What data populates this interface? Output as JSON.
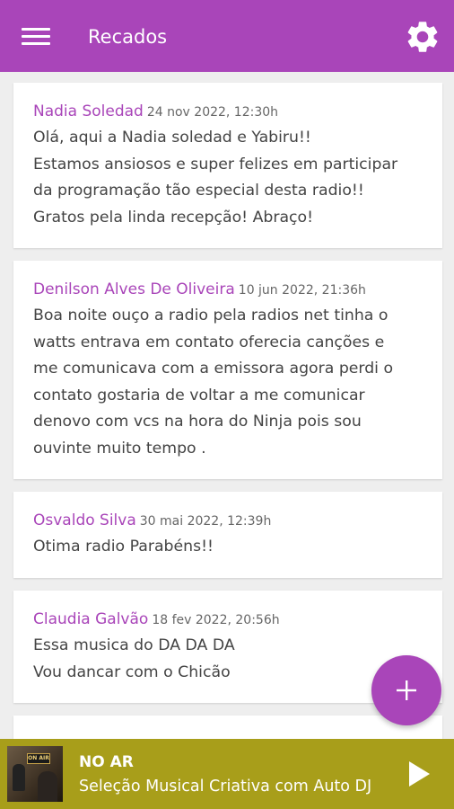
{
  "header": {
    "title": "Recados",
    "menu_icon": "hamburger-menu-icon",
    "settings_icon": "gear-icon",
    "background_color": "#a945b9"
  },
  "messages": [
    {
      "author": "Nadia Soledad",
      "date": "24 nov 2022, 12:30h",
      "text": "Olá, aqui a Nadia soledad e Yabiru!!\nEstamos ansiosos e super felizes em participar\nda programação tão especial desta radio!!\nGratos pela linda recepção! Abraço!"
    },
    {
      "author": "Denilson Alves De Oliveira",
      "date": "10 jun 2022, 21:36h",
      "text": "Boa noite ouço  a radio pela radios net tinha o\nwatts  entrava em contato oferecia canções  e\nme comunicava com a emissora agora perdi o\ncontato gostaria de voltar a me comunicar\ndenovo com vcs na hora do Ninja pois sou\nouvinte muito tempo ."
    },
    {
      "author": "Osvaldo Silva",
      "date": "30 mai 2022, 12:39h",
      "text": "Otima radio Parabéns!!"
    },
    {
      "author": "Claudia Galvão",
      "date": "18 fev 2022, 20:56h",
      "text": "Essa musica do DA DA DA\nVou dancar com o Chicão"
    }
  ],
  "fab": {
    "icon": "plus-icon"
  },
  "player": {
    "status_label": "NO AR",
    "program_title": "Seleção Musical Criativa com Auto DJ",
    "thumbnail_sign": "ON AIR",
    "play_icon": "play-icon",
    "background_color": "#a89e1a"
  },
  "colors": {
    "accent": "#a945b9",
    "author_text": "#a945b9",
    "body_text": "#444444",
    "date_text": "#666666",
    "background": "#eeeeee"
  }
}
